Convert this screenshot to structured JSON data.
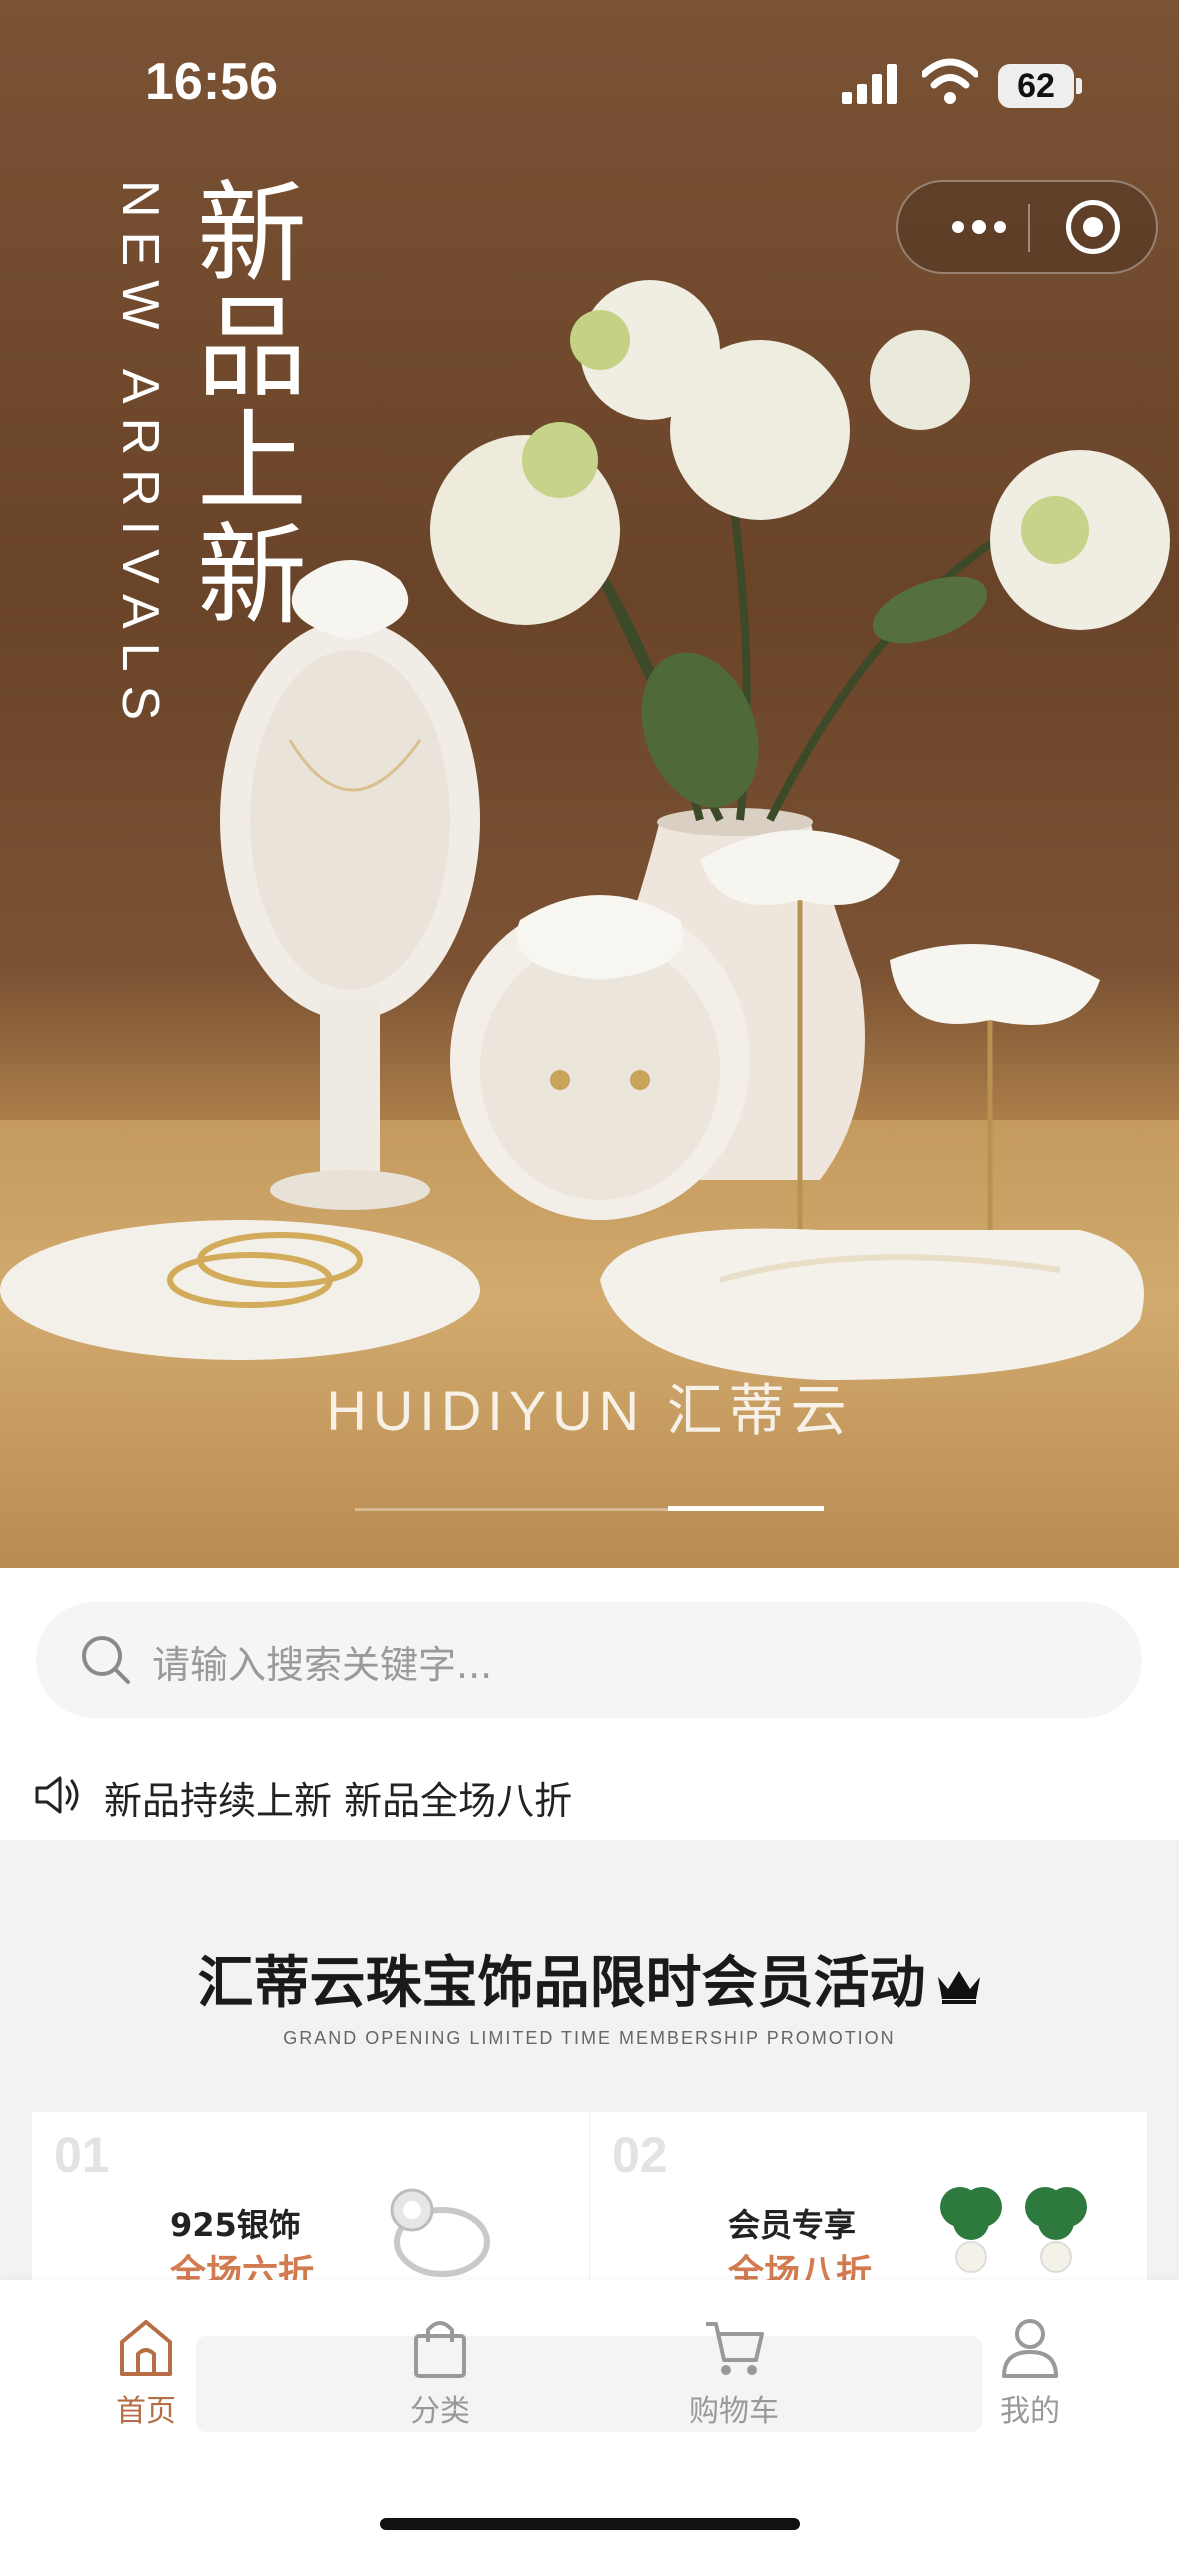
{
  "status_bar": {
    "time": "16:56",
    "battery": "62"
  },
  "hero": {
    "title_cn": "新品上新",
    "title_en": "NEW ARRIVALS",
    "brand": "HUIDIYUN 汇蒂云",
    "carousel": {
      "total_slides": 2,
      "active_slide": 2
    }
  },
  "search": {
    "placeholder": "请输入搜索关键字..."
  },
  "notice": {
    "text": "新品持续上新 新品全场八折"
  },
  "promo": {
    "title": "汇蒂云珠宝饰品限时会员活动",
    "subtitle": "GRAND OPENING LIMITED TIME MEMBERSHIP PROMOTION",
    "cards": [
      {
        "num": "01",
        "label": "925银饰",
        "offer": "全场六折"
      },
      {
        "num": "02",
        "label": "会员专享",
        "offer": "全场八折"
      }
    ]
  },
  "tabbar": {
    "tabs": [
      {
        "label": "首页",
        "active": true
      },
      {
        "label": "分类",
        "active": false
      },
      {
        "label": "购物车",
        "active": false
      },
      {
        "label": "我的",
        "active": false
      }
    ]
  },
  "colors": {
    "accent": "#b56e45",
    "offer": "#d27a50",
    "hero_bg": "#6a4429"
  }
}
